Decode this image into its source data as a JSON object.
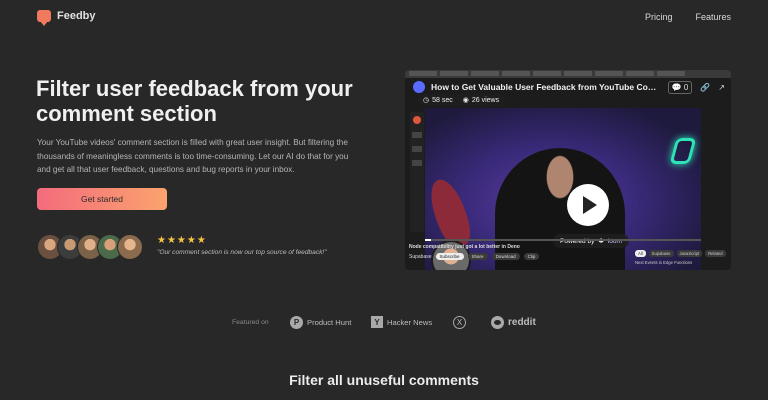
{
  "brand": {
    "name": "Feedby",
    "accent": "#f07a5e"
  },
  "nav": {
    "pricing": "Pricing",
    "features": "Features"
  },
  "hero": {
    "title": "Filter user feedback from your comment section",
    "description": "Your YouTube videos' comment section is filled with great user insight. But filtering the thousands of meaningless comments is too time-consuming. Let our AI do that for you and get all that user feedback, questions and bug reports in your inbox.",
    "cta": "Get started",
    "stars": "★★★★★",
    "quote": "\"Our comment section is now our top source of feedback!\""
  },
  "video": {
    "title": "How to Get Valuable User Feedback from YouTube Com...",
    "duration": "58 sec",
    "views": "26 views",
    "comment_count": "0",
    "powered_by": "Powered by",
    "loom": "loom",
    "progress": 0.02,
    "caption": "Node compatibility just got a lot better in Deno",
    "channel": "Supabase",
    "subscribe": "Subscribe",
    "actions": [
      "Share",
      "Download",
      "Clip"
    ],
    "chips": [
      "All",
      "Supabase",
      "JavaScript",
      "Related"
    ],
    "next": "Next Events in Edge Functions"
  },
  "featured": {
    "label": "Featured on",
    "product_hunt": "Product Hunt",
    "hacker_news": "Hacker News",
    "reddit": "reddit"
  },
  "section2": {
    "title": "Filter all unuseful comments"
  }
}
